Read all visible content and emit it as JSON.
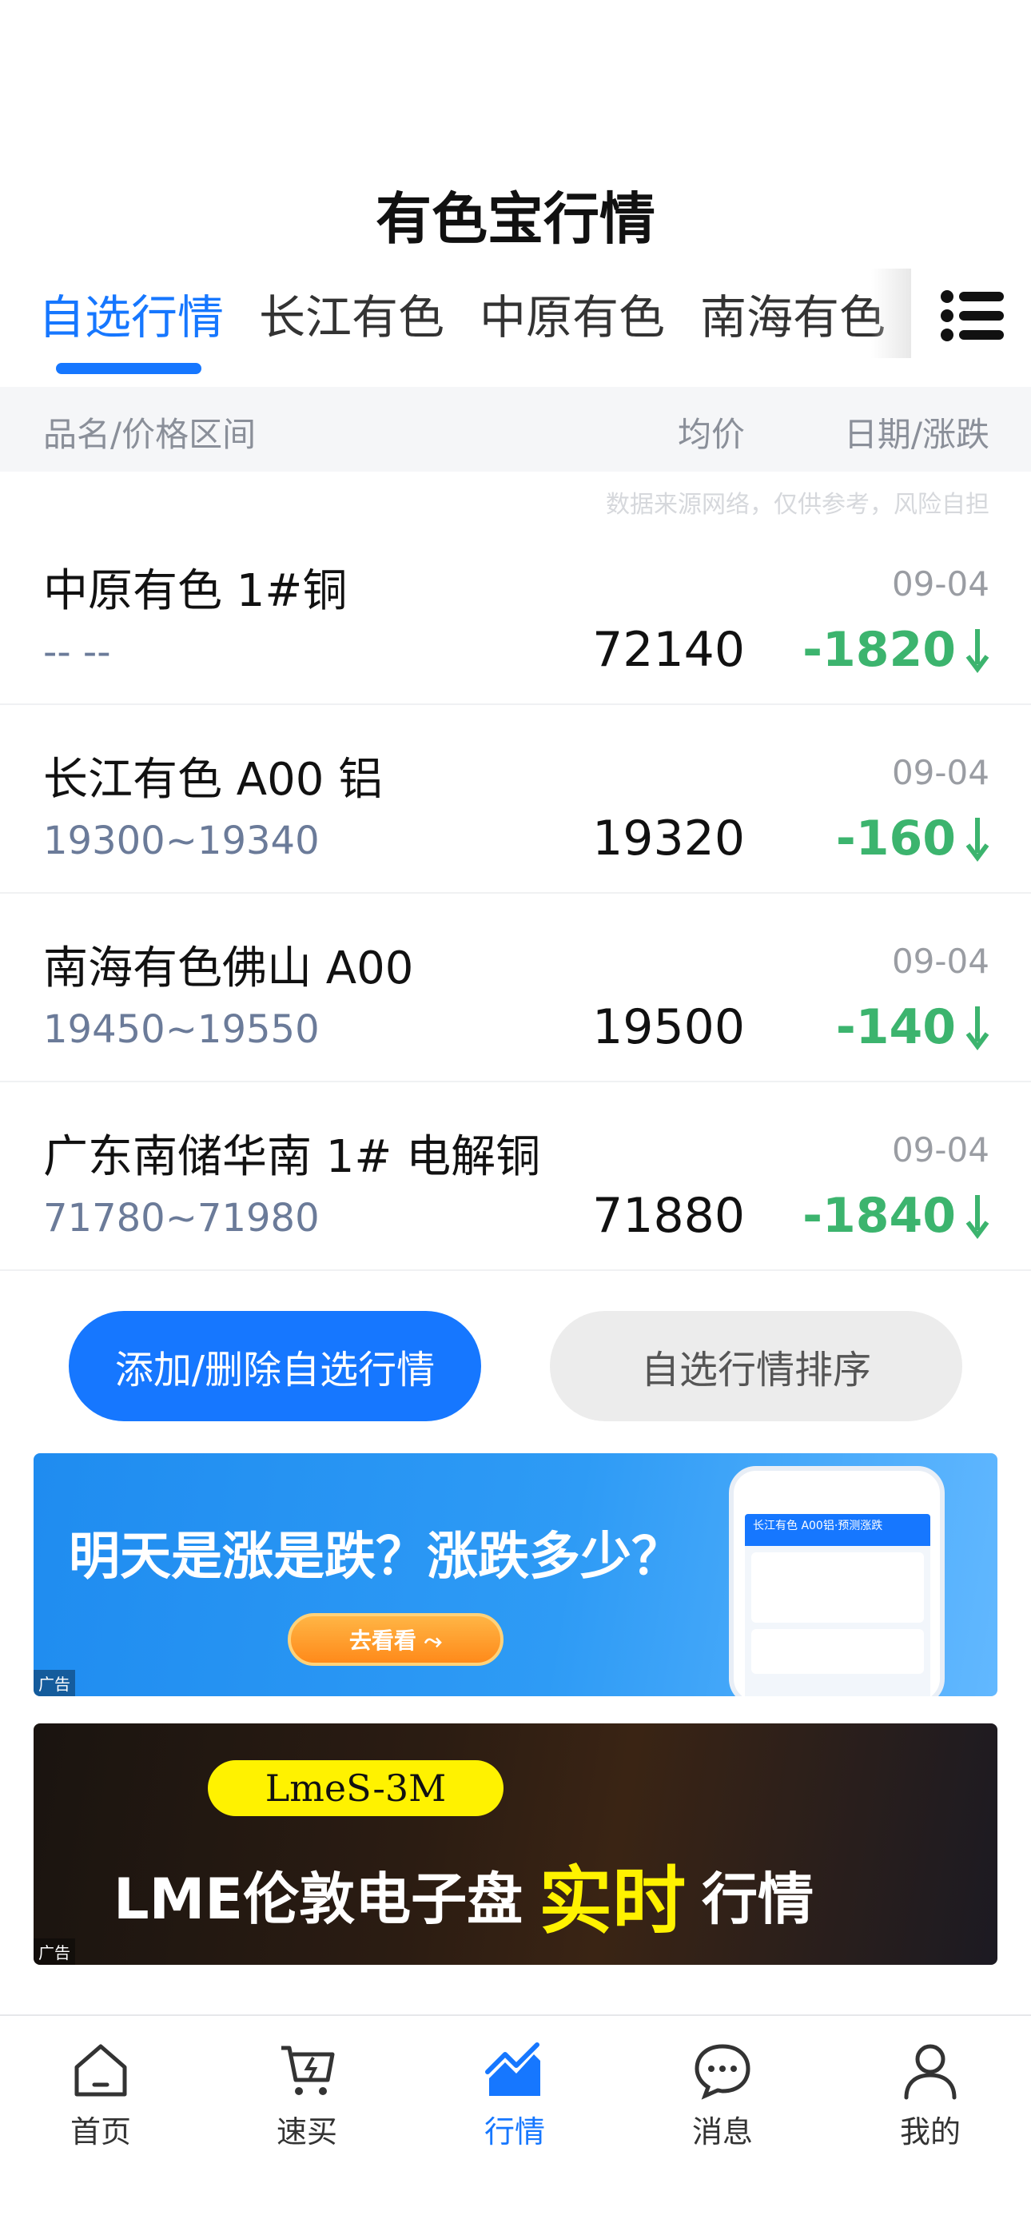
{
  "header": {
    "title": "有色宝行情"
  },
  "tabs": [
    {
      "label": "自选行情",
      "active": true
    },
    {
      "label": "长江有色",
      "active": false
    },
    {
      "label": "中原有色",
      "active": false
    },
    {
      "label": "南海有色",
      "active": false
    }
  ],
  "menu_icon": "list-icon",
  "table_header": {
    "name": "品名/价格区间",
    "avg": "均价",
    "date_change": "日期/涨跌"
  },
  "disclaimer": "数据来源网络，仅供参考，风险自担",
  "rows": [
    {
      "name": "中原有色 1#铜",
      "date": "09-04",
      "range": "-- --",
      "avg": "72140",
      "change": "-1820"
    },
    {
      "name": "长江有色 A00 铝",
      "date": "09-04",
      "range": "19300~19340",
      "avg": "19320",
      "change": "-160"
    },
    {
      "name": "南海有色佛山 A00",
      "date": "09-04",
      "range": "19450~19550",
      "avg": "19500",
      "change": "-140"
    },
    {
      "name": "广东南储华南 1# 电解铜",
      "date": "09-04",
      "range": "71780~71980",
      "avg": "71880",
      "change": "-1840"
    }
  ],
  "buttons": {
    "edit": "添加/删除自选行情",
    "sort": "自选行情排序"
  },
  "ads": [
    {
      "headline": "明天是涨是跌？涨跌多少？",
      "cta": "去看看 ⤳",
      "phone_title": "长江有色 A00铝·预测涨跌",
      "tag": "广告"
    },
    {
      "badge": "LmeS-3M",
      "text_pre": "LME伦敦电子盘",
      "text_highlight": "实时",
      "text_post": "行情",
      "tag": "广告"
    }
  ],
  "colors": {
    "accent": "#1677ff",
    "down": "#3cb46e"
  },
  "nav": [
    {
      "label": "首页",
      "icon": "home-icon",
      "active": false
    },
    {
      "label": "速买",
      "icon": "cart-icon",
      "active": false
    },
    {
      "label": "行情",
      "icon": "chart-icon",
      "active": true
    },
    {
      "label": "消息",
      "icon": "message-icon",
      "active": false
    },
    {
      "label": "我的",
      "icon": "user-icon",
      "active": false
    }
  ]
}
